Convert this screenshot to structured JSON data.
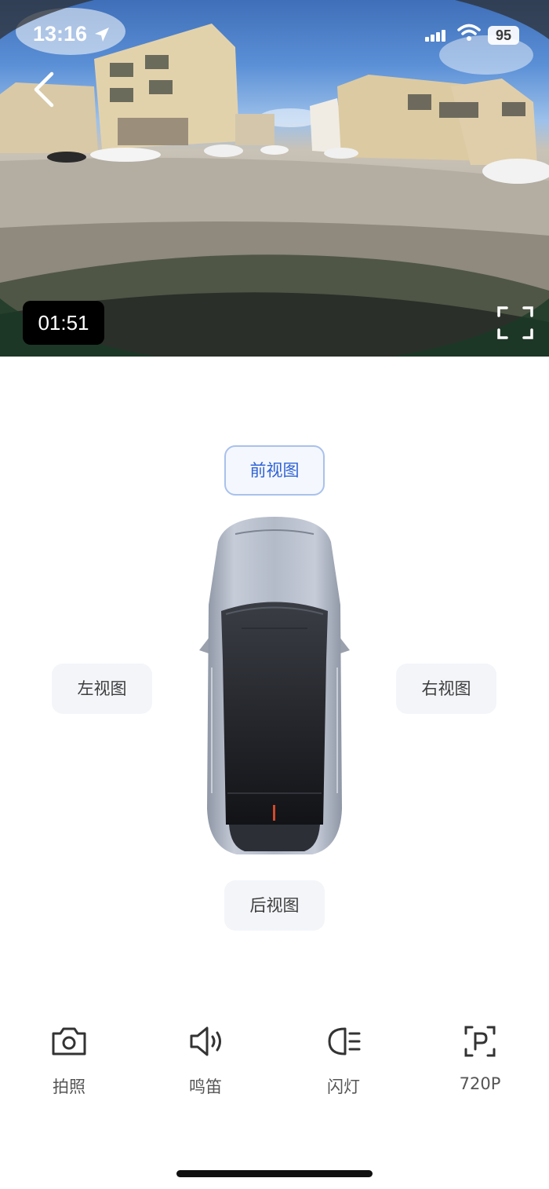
{
  "status_bar": {
    "time": "13:16",
    "battery": "95",
    "icons": [
      "location-arrow-icon",
      "cellular-signal-icon",
      "wifi-icon",
      "battery-icon"
    ]
  },
  "camera": {
    "timer": "01:51",
    "icons": [
      "back-chevron-icon",
      "fullscreen-icon"
    ]
  },
  "views": {
    "front": "前视图",
    "left": "左视图",
    "right": "右视图",
    "rear": "后视图",
    "selected": "front"
  },
  "toolbar": {
    "photo": "拍照",
    "horn": "鸣笛",
    "flash": "闪灯",
    "resolution": "720P"
  },
  "colors": {
    "accent": "#2f63d4",
    "active_border": "#a9c1ec",
    "button_bg": "#f3f5f9"
  }
}
